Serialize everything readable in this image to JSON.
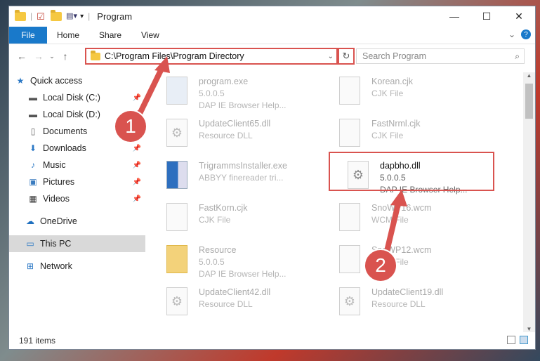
{
  "window": {
    "title": "Program"
  },
  "ribbon": {
    "tabs": [
      "File",
      "Home",
      "Share",
      "View"
    ]
  },
  "address": {
    "path": "C:\\Program Files\\Program Directory",
    "search_placeholder": "Search Program"
  },
  "sidebar": {
    "items": [
      {
        "label": "Quick access",
        "icon": "star-icon"
      },
      {
        "label": "Local Disk (C:)",
        "icon": "drive-icon"
      },
      {
        "label": "Local Disk (D:)",
        "icon": "drive-icon"
      },
      {
        "label": "Documents",
        "icon": "documents-icon"
      },
      {
        "label": "Downloads",
        "icon": "downloads-icon"
      },
      {
        "label": "Music",
        "icon": "music-icon"
      },
      {
        "label": "Pictures",
        "icon": "pictures-icon"
      },
      {
        "label": "Videos",
        "icon": "videos-icon"
      },
      {
        "label": "OneDrive",
        "icon": "cloud-icon"
      },
      {
        "label": "This PC",
        "icon": "computer-icon"
      },
      {
        "label": "Network",
        "icon": "network-icon"
      }
    ]
  },
  "files": [
    {
      "name": "program.exe",
      "line1": "5.0.0.5",
      "line2": "DAP IE Browser Help..."
    },
    {
      "name": "Korean.cjk",
      "line1": "CJK File",
      "line2": ""
    },
    {
      "name": "UpdateClient65.dll",
      "line1": "Resource DLL",
      "line2": ""
    },
    {
      "name": "FastNrml.cjk",
      "line1": "CJK File",
      "line2": ""
    },
    {
      "name": "TrigrammsInstaller.exe",
      "line1": "ABBYY finereader tri...",
      "line2": ""
    },
    {
      "name": "dapbho.dll",
      "line1": "5.0.0.5",
      "line2": "DAP IE Browser Help..."
    },
    {
      "name": "FastKorn.cjk",
      "line1": "CJK File",
      "line2": ""
    },
    {
      "name": "SnoWP16.wcm",
      "line1": "WCM File",
      "line2": ""
    },
    {
      "name": "Resource",
      "line1": "5.0.0.5",
      "line2": "DAP IE Browser Help..."
    },
    {
      "name": "SnoWP12.wcm",
      "line1": "WCM File",
      "line2": ""
    },
    {
      "name": "UpdateClient42.dll",
      "line1": "Resource DLL",
      "line2": ""
    },
    {
      "name": "UpdateClient19.dll",
      "line1": "Resource DLL",
      "line2": ""
    }
  ],
  "status": {
    "items": "191 items"
  },
  "annotations": {
    "badge1": "1",
    "badge2": "2"
  }
}
